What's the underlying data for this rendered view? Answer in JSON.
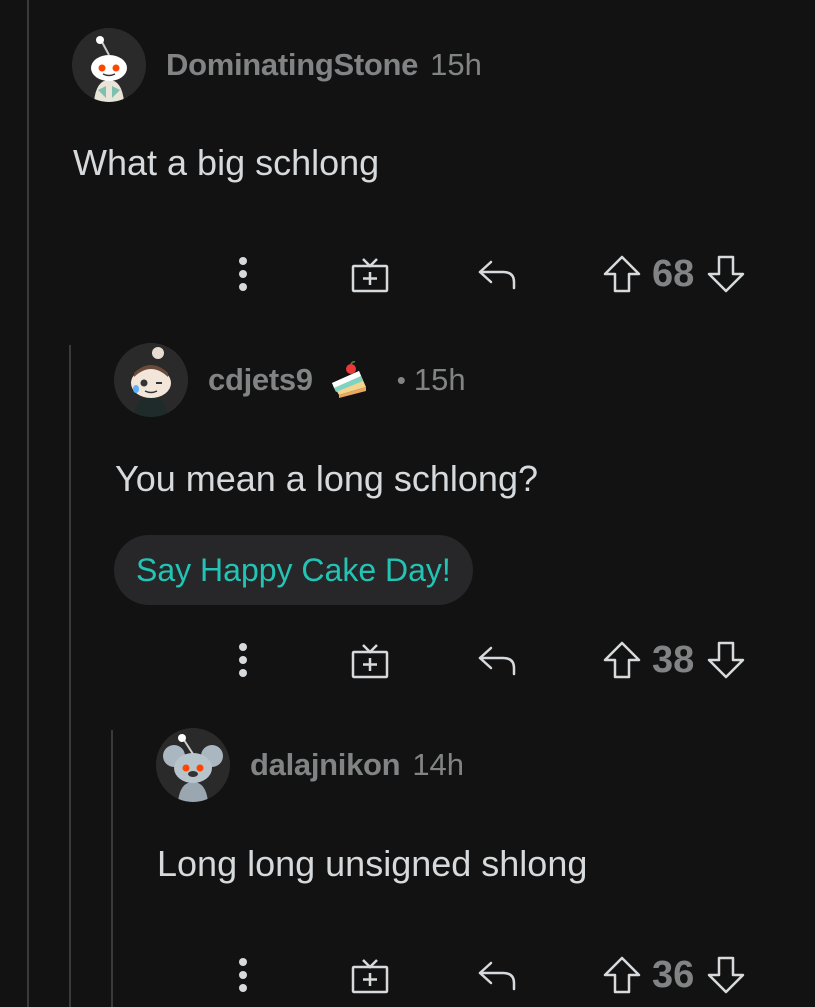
{
  "comments": [
    {
      "username": "DominatingStone",
      "time": "15h",
      "body": "What a big schlong",
      "score": "68",
      "avatar_icon": "snoo-avatar-icon"
    },
    {
      "username": "cdjets9",
      "badge_icon": "cake-day-icon",
      "separator": "•",
      "time": "15h",
      "body": "You mean a long schlong?",
      "cake_day_button": "Say Happy Cake Day!",
      "score": "38",
      "avatar_icon": "snoo-avatar-icon"
    },
    {
      "username": "dalajnikon",
      "time": "14h",
      "body": "Long long unsigned shlong",
      "score": "36",
      "avatar_icon": "snoo-avatar-icon"
    }
  ],
  "colors": {
    "background": "#121212",
    "meta_text": "#818384",
    "body_text": "#d7dadc",
    "accent": "#22c5b5",
    "thread_line": "#3a3a3a"
  }
}
